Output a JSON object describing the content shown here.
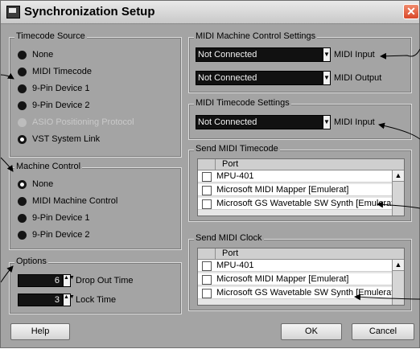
{
  "window": {
    "title": "Synchronization Setup",
    "close_glyph": "✕"
  },
  "timecode_source": {
    "legend": "Timecode Source",
    "options": [
      {
        "label": "None",
        "state": "unselected"
      },
      {
        "label": "MIDI Timecode",
        "state": "unselected"
      },
      {
        "label": "9-Pin Device 1",
        "state": "unselected"
      },
      {
        "label": "9-Pin Device 2",
        "state": "unselected"
      },
      {
        "label": "ASIO Positioning Protocol",
        "state": "disabled"
      },
      {
        "label": "VST System Link",
        "state": "selected"
      }
    ]
  },
  "machine_control": {
    "legend": "Machine Control",
    "options": [
      {
        "label": "None",
        "state": "selected"
      },
      {
        "label": "MIDI Machine Control",
        "state": "unselected"
      },
      {
        "label": "9-Pin Device 1",
        "state": "unselected"
      },
      {
        "label": "9-Pin Device 2",
        "state": "unselected"
      }
    ]
  },
  "options": {
    "legend": "Options",
    "drop_out_time": {
      "value": "6",
      "label": "Drop Out Time"
    },
    "lock_time": {
      "value": "3",
      "label": "Lock Time"
    }
  },
  "mmc_settings": {
    "legend": "MIDI Machine Control Settings",
    "input": {
      "value": "Not Connected",
      "label": "MIDI Input"
    },
    "output": {
      "value": "Not Connected",
      "label": "MIDI Output"
    }
  },
  "mtc_settings": {
    "legend": "MIDI Timecode Settings",
    "input": {
      "value": "Not Connected",
      "label": "MIDI Input"
    }
  },
  "send_mtc": {
    "legend": "Send MIDI Timecode",
    "header": "Port",
    "ports": [
      "MPU-401",
      "Microsoft MIDI Mapper [Emulerat]",
      "Microsoft GS Wavetable SW Synth [Emulerat]"
    ]
  },
  "send_clock": {
    "legend": "Send MIDI Clock",
    "header": "Port",
    "ports": [
      "MPU-401",
      "Microsoft MIDI Mapper [Emulerat]",
      "Microsoft GS Wavetable SW Synth [Emulerat]"
    ]
  },
  "buttons": {
    "help": "Help",
    "ok": "OK",
    "cancel": "Cancel"
  },
  "icons": {
    "dropdown": "▼",
    "scroll_up": "▲",
    "spin": "▲▼"
  }
}
